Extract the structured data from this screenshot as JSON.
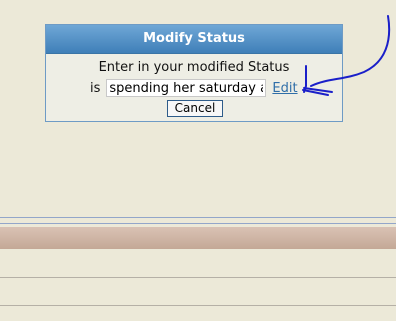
{
  "dialog": {
    "title": "Modify Status",
    "prompt": "Enter in your modified Status",
    "is_label": "is",
    "status_value": "spending her saturday a",
    "edit_link": "Edit",
    "cancel_label": "Cancel"
  },
  "colors": {
    "page_background": "#ECE9D8",
    "header_blue": "#4F8FC7",
    "link_blue": "#2F6EA8",
    "annotation_ink": "#1A1FC9",
    "tan_bar": "#CDB4A4"
  }
}
